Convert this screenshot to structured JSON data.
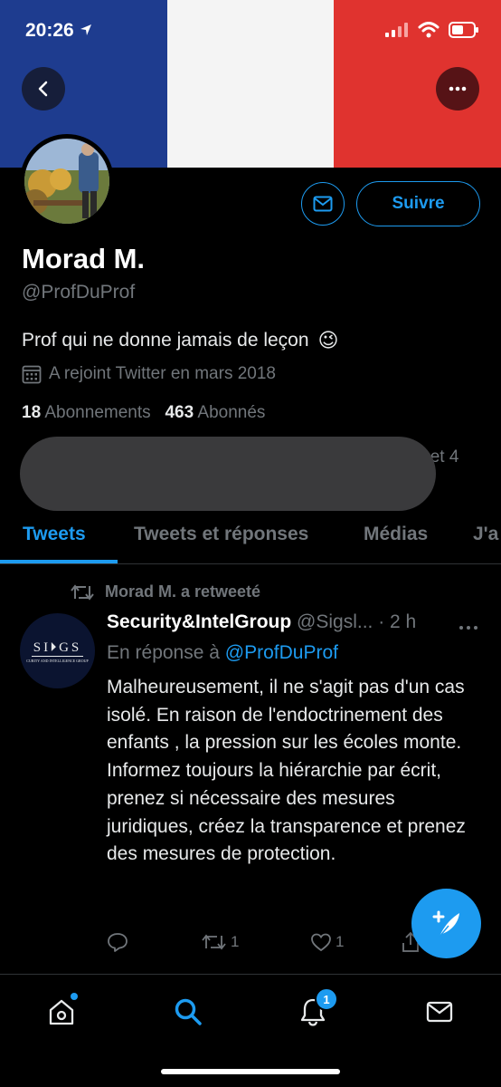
{
  "status_bar": {
    "time": "20:26"
  },
  "banner": {
    "colors": [
      "#1e3c8f",
      "#f4f4f4",
      "#e0332f"
    ]
  },
  "header": {
    "back_icon": "chevron-left-icon",
    "more_icon": "more-icon"
  },
  "profile": {
    "name": "Morad M.",
    "handle": "@ProfDuProf",
    "bio": "Prof qui ne donne jamais de leçon",
    "bio_emoji": "😉",
    "joined": "A rejoint Twitter en mars 2018",
    "following_count": "18",
    "following_label": "Abonnements",
    "followers_count": "463",
    "followers_label": "Abonnés",
    "follow_button": "Suivre",
    "followed_by_tail": "li et 4"
  },
  "tabs": [
    {
      "label": "Tweets",
      "active": true
    },
    {
      "label": "Tweets et réponses",
      "active": false
    },
    {
      "label": "Médias",
      "active": false
    },
    {
      "label": "J'a",
      "active": false
    }
  ],
  "tweet": {
    "retweet_label": "Morad M. a retweeté",
    "author": "Security&IntelGroup",
    "author_handle_time": "@Sigsl... · 2 h",
    "avatar_text": "SI🞂GS",
    "avatar_subtext": "CURITY AND INTELLIGENCE GROUP",
    "reply_prefix": "En réponse à",
    "reply_mention": "@ProfDuProf",
    "text": "Malheureusement, il ne s'agit pas d'un cas isolé. En raison de l'endoctrinement des enfants , la pression sur les écoles monte. Informez toujours la hiérarchie par écrit, prenez si nécessaire des mesures juridiques, créez la transparence et prenez des mesures de protection.",
    "retweet_count": "1",
    "like_count": "1"
  },
  "bottom_nav": {
    "notification_badge": "1"
  },
  "accent_color": "#1d9bf0"
}
